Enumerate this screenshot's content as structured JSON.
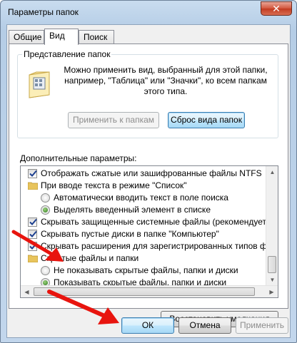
{
  "window": {
    "title": "Параметры папок",
    "close_glyph": "✕"
  },
  "tabs": [
    {
      "label": "Общие"
    },
    {
      "label": "Вид"
    },
    {
      "label": "Поиск"
    }
  ],
  "folder_view": {
    "group_label": "Представление папок",
    "description": "Можно применить вид, выбранный для этой папки, например, \"Таблица\" или \"Значки\", ко всем папкам этого типа.",
    "apply_label": "Применить к папкам",
    "reset_label": "Сброс вида папок"
  },
  "advanced": {
    "label": "Дополнительные параметры:",
    "items": [
      {
        "type": "checkbox",
        "checked": true,
        "label": "Отображать сжатые или зашифрованные файлы NTFS"
      },
      {
        "type": "folder",
        "label": "При вводе текста в режиме \"Список\""
      },
      {
        "type": "radio",
        "checked": false,
        "label": "Автоматически вводить текст в поле поиска"
      },
      {
        "type": "radio",
        "checked": true,
        "label": "Выделять введенный элемент в списке"
      },
      {
        "type": "checkbox",
        "checked": true,
        "label": "Скрывать защищенные системные файлы (рекомендуется)"
      },
      {
        "type": "checkbox",
        "checked": true,
        "label": "Скрывать пустые диски в папке \"Компьютер\""
      },
      {
        "type": "checkbox",
        "checked": true,
        "label": "Скрывать расширения для зарегистрированных типов файлов"
      },
      {
        "type": "folder",
        "label": "Скрытые файлы и папки"
      },
      {
        "type": "radio",
        "checked": false,
        "label": "Не показывать скрытые файлы, папки и диски"
      },
      {
        "type": "radio",
        "checked": true,
        "label": "Показывать скрытые файлы, папки и диски"
      }
    ],
    "restore_label": "Восстановить умолчания"
  },
  "footer": {
    "ok_label": "ОК",
    "cancel_label": "Отмена",
    "apply_label": "Применить"
  },
  "colors": {
    "annotation_arrow": "#e8140e"
  }
}
